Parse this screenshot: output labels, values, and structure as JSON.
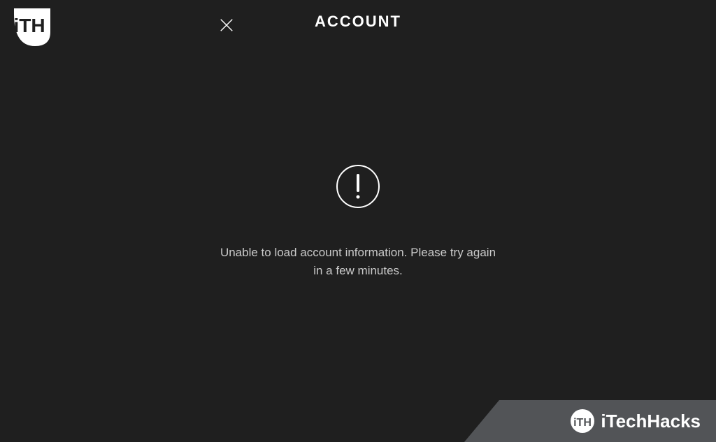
{
  "header": {
    "title": "ACCOUNT"
  },
  "error": {
    "message": "Unable to load account information. Please try again in a few minutes."
  },
  "watermark": {
    "label": "iTechHacks"
  }
}
